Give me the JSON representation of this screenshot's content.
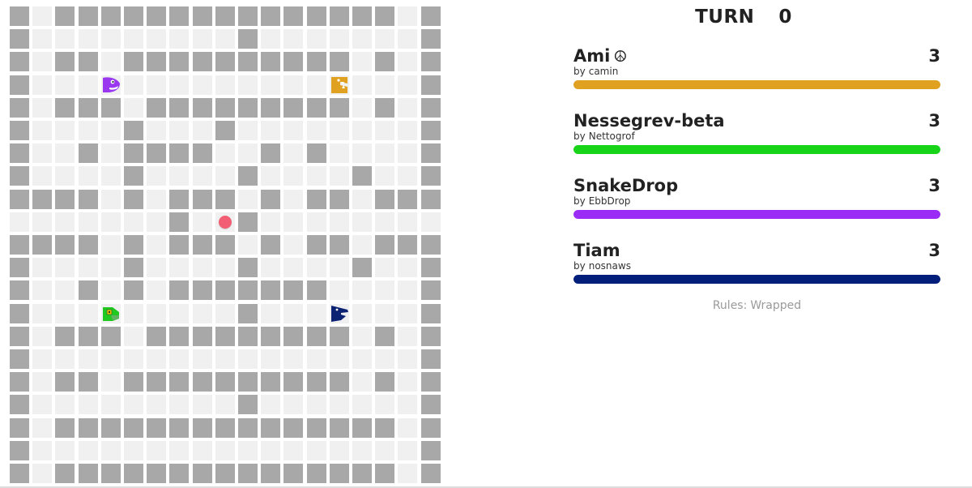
{
  "turn": {
    "label": "TURN",
    "value": "0"
  },
  "board": {
    "cols": 19,
    "rows": 21,
    "empty_color": "#f0f0f0",
    "hazard_color": "#a8a8a8",
    "hazard_rows": [
      "1011111111111111101",
      "1000000000100000001",
      "1011011111111110101",
      "1000000000000000001",
      "1011101111111110101",
      "1000010001000000001",
      "1001011110010100001",
      "1000010000100001001",
      "1111010111010110111",
      "0000000100100000000",
      "1111010111010110111",
      "1000010000100001001",
      "1001010111111100001",
      "1000000000100000001",
      "1011101111111110101",
      "1000000000000000001",
      "1011011111111110101",
      "1000000000100000001",
      "1011111111111111101",
      "1000000000000000001",
      "1011111111111111101"
    ],
    "food": [
      {
        "col": 9,
        "row": 9,
        "color": "#f25e73"
      }
    ],
    "snakes": [
      {
        "name": "Ami",
        "col": 14,
        "row": 3,
        "color": "#e0a020",
        "icon": "fang-snake-head-icon",
        "facing": "right"
      },
      {
        "name": "SnakeDrop",
        "col": 4,
        "row": 3,
        "color": "#9a38f0",
        "icon": "beluga-snake-head-icon",
        "facing": "right"
      },
      {
        "name": "Nessegrev-beta",
        "col": 4,
        "row": 13,
        "color": "#1fc91f",
        "icon": "gamer-snake-head-icon",
        "facing": "right"
      },
      {
        "name": "Tiam",
        "col": 14,
        "row": 13,
        "color": "#0b2273",
        "icon": "shark-snake-head-icon",
        "facing": "right"
      }
    ]
  },
  "players": [
    {
      "name": "Ami",
      "emoji": "☮",
      "author_prefix": "by",
      "author": "camin",
      "length": "3",
      "health": 1.0,
      "color": "#e0a020"
    },
    {
      "name": "Nessegrev-beta",
      "emoji": "",
      "author_prefix": "by",
      "author": "Nettogrof",
      "length": "3",
      "health": 1.0,
      "color": "#17d418"
    },
    {
      "name": "SnakeDrop",
      "emoji": "",
      "author_prefix": "by",
      "author": "EbbDrop",
      "length": "3",
      "health": 1.0,
      "color": "#9a2cf5"
    },
    {
      "name": "Tiam",
      "emoji": "",
      "author_prefix": "by",
      "author": "nosnaws",
      "length": "3",
      "health": 1.0,
      "color": "#011f7a"
    }
  ],
  "rules": {
    "label": "Rules:",
    "value": "Wrapped"
  }
}
